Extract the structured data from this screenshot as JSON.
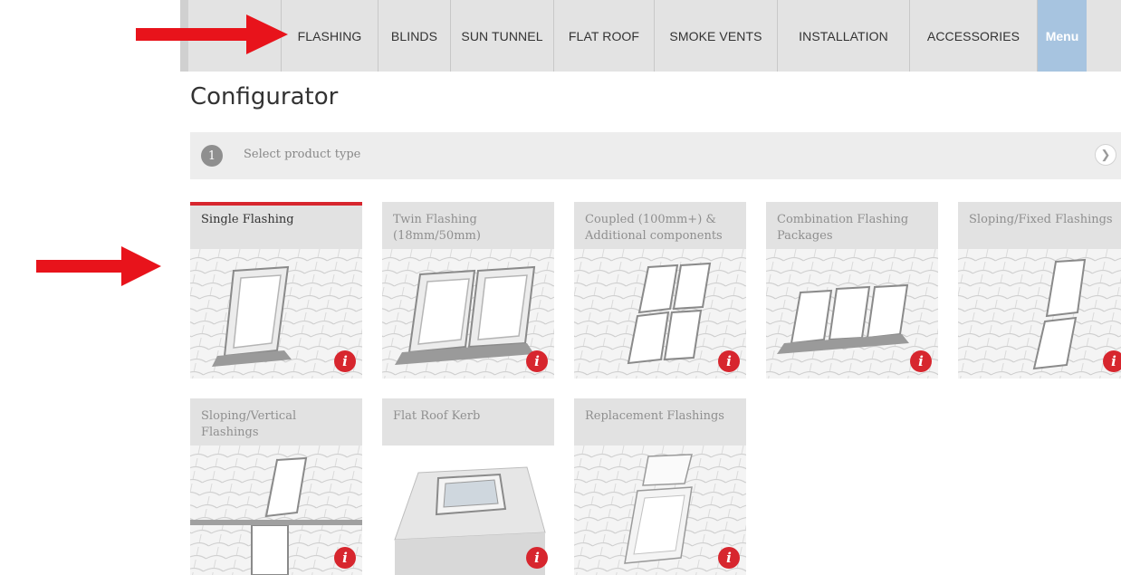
{
  "nav": {
    "items": [
      "FLASHING",
      "BLINDS",
      "SUN TUNNEL",
      "FLAT ROOF",
      "SMOKE VENTS",
      "INSTALLATION",
      "ACCESSORIES"
    ],
    "menu_label": "Menu"
  },
  "page": {
    "title": "Configurator"
  },
  "step": {
    "number": "1",
    "label": "Select product type"
  },
  "tiles": [
    {
      "label": "Single Flashing",
      "selected": true
    },
    {
      "label": "Twin Flashing\n(18mm/50mm)",
      "selected": false
    },
    {
      "label": "Coupled (100mm+) &\nAdditional components",
      "selected": false
    },
    {
      "label": "Combination Flashing\nPackages",
      "selected": false
    },
    {
      "label": "Sloping/Fixed Flashings",
      "selected": false
    },
    {
      "label": "Sloping/Vertical\nFlashings",
      "selected": false
    },
    {
      "label": "Flat Roof Kerb",
      "selected": false
    },
    {
      "label": "Replacement Flashings",
      "selected": false
    }
  ],
  "info_glyph": "i",
  "colors": {
    "accent_red": "#d7262e",
    "menu_blue": "#a7c4e0",
    "nav_bg": "#e3e3e3"
  }
}
